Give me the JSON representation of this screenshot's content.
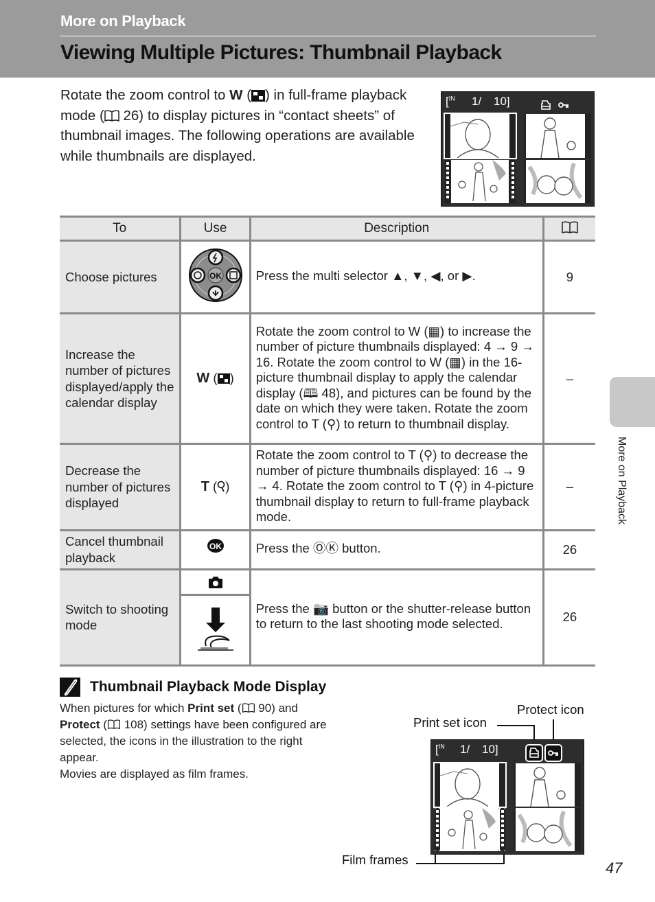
{
  "header": {
    "section": "More on Playback",
    "title": "Viewing Multiple Pictures: Thumbnail Playback"
  },
  "intro": {
    "part1": "Rotate the zoom control to ",
    "w": "W",
    "part2": ") in full-frame playback mode (",
    "ref": " 26) to display pictures in “contact sheets” of thumbnail images. The following operations are available while thumbnails are displayed."
  },
  "screen": {
    "memory": "IN",
    "counter_current": "1/",
    "counter_total": "10",
    "icons": [
      "print-set-icon",
      "protect-icon"
    ]
  },
  "table": {
    "headers": {
      "to": "To",
      "use": "Use",
      "description": "Description",
      "ref_icon": "book-icon"
    },
    "rows": [
      {
        "to": "Choose pictures",
        "use_icon": "multi-selector-icon",
        "description": "Press the multi selector ▲, ▼, ◀, or ▶.",
        "ref": "9"
      },
      {
        "to": "Increase the number of pictures displayed/apply the calendar display",
        "use_label": "W",
        "use_icon": "thumbnail-grid-icon",
        "description": "Rotate the zoom control to W (▦) to increase the number of picture thumbnails displayed: 4 → 9 → 16. Rotate the zoom control to W (▦) in the 16-picture thumbnail display to apply the calendar display (🕮 48), and pictures can be found by the date on which they were taken. Rotate the zoom control to T (⚲) to return to thumbnail display.",
        "ref": "–"
      },
      {
        "to": "Decrease the number of pictures displayed",
        "use_label": "T",
        "use_icon": "magnify-icon",
        "description": "Rotate the zoom control to T (⚲) to decrease the number of picture thumbnails displayed: 16 → 9 → 4. Rotate the zoom control to T (⚲) in 4-picture thumbnail display to return to full-frame playback mode.",
        "ref": "–"
      },
      {
        "to": "Cancel thumbnail playback",
        "use_icon": "ok-button-icon",
        "description": "Press the ⓄⓀ button.",
        "ref": "26"
      },
      {
        "to": "Switch to shooting mode",
        "use_icon": "camera-icon",
        "use_icon2": "shutter-press-icon",
        "description": "Press the 📷 button or the shutter-release button to return to the last shooting mode selected.",
        "ref": "26"
      }
    ]
  },
  "note": {
    "title": "Thumbnail Playback Mode Display",
    "body_pre": "When pictures for which ",
    "print_set": "Print set",
    "ref1": " 90) and ",
    "protect": "Protect",
    "ref2": " 108) settings have been configured are selected, the icons in the illustration to the right appear.",
    "movies": "Movies are displayed as film frames."
  },
  "callouts": {
    "print_set_icon": "Print set icon",
    "protect_icon": "Protect icon",
    "film_frames": "Film frames"
  },
  "side_tab": {
    "label": "More on Playback"
  },
  "page_number": "47"
}
